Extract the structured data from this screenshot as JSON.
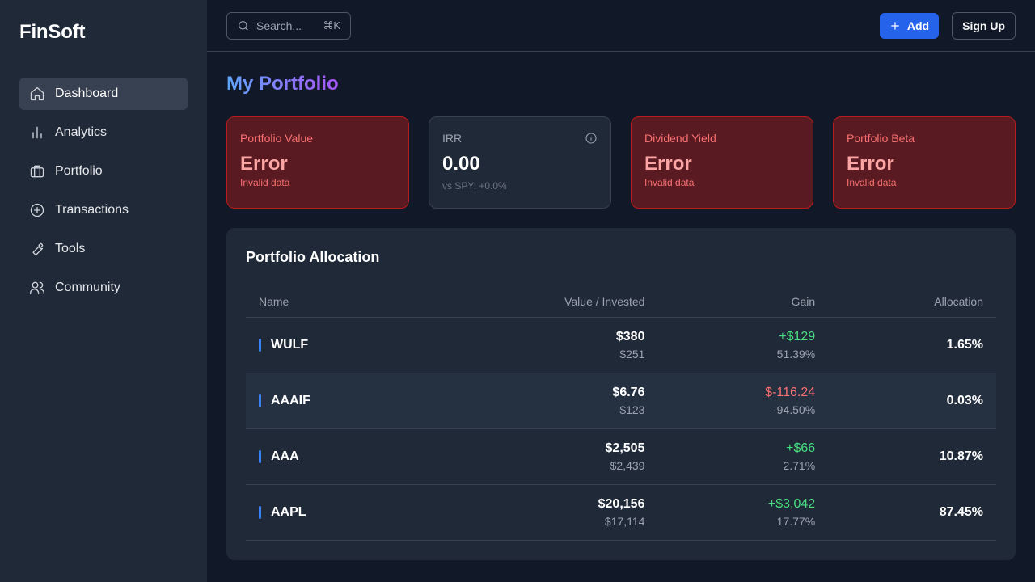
{
  "app": {
    "name": "FinSoft"
  },
  "sidebar": {
    "items": [
      {
        "label": "Dashboard",
        "icon": "home-icon",
        "active": true
      },
      {
        "label": "Analytics",
        "icon": "bar-chart-icon"
      },
      {
        "label": "Portfolio",
        "icon": "briefcase-icon"
      },
      {
        "label": "Transactions",
        "icon": "plus-circle-icon"
      },
      {
        "label": "Tools",
        "icon": "wrench-icon"
      },
      {
        "label": "Community",
        "icon": "users-icon"
      }
    ]
  },
  "topbar": {
    "search_placeholder": "Search...",
    "search_shortcut": "⌘K",
    "add_label": "Add",
    "signup_label": "Sign Up"
  },
  "page": {
    "title": "My Portfolio"
  },
  "cards": [
    {
      "label": "Portfolio Value",
      "value": "Error",
      "sub": "Invalid data",
      "state": "error"
    },
    {
      "label": "IRR",
      "value": "0.00",
      "sub": "vs SPY: +0.0%",
      "state": "normal"
    },
    {
      "label": "Dividend Yield",
      "value": "Error",
      "sub": "Invalid data",
      "state": "error"
    },
    {
      "label": "Portfolio Beta",
      "value": "Error",
      "sub": "Invalid data",
      "state": "error"
    }
  ],
  "allocation": {
    "title": "Portfolio Allocation",
    "columns": [
      "Name",
      "Value / Invested",
      "Gain",
      "Allocation"
    ],
    "rows": [
      {
        "name": "WULF",
        "value": "$380",
        "invested": "$251",
        "gain": "+$129",
        "gain_pct": "51.39%",
        "allocation": "1.65%",
        "positive": true
      },
      {
        "name": "AAAIF",
        "value": "$6.76",
        "invested": "$123",
        "gain": "$-116.24",
        "gain_pct": "-94.50%",
        "allocation": "0.03%",
        "positive": false
      },
      {
        "name": "AAA",
        "value": "$2,505",
        "invested": "$2,439",
        "gain": "+$66",
        "gain_pct": "2.71%",
        "allocation": "10.87%",
        "positive": true
      },
      {
        "name": "AAPL",
        "value": "$20,156",
        "invested": "$17,114",
        "gain": "+$3,042",
        "gain_pct": "17.77%",
        "allocation": "87.45%",
        "positive": true
      }
    ]
  },
  "colors": {
    "accent": "#2563eb",
    "positive": "#4ade80",
    "negative": "#f87171",
    "error_bg": "#5a1a22"
  }
}
